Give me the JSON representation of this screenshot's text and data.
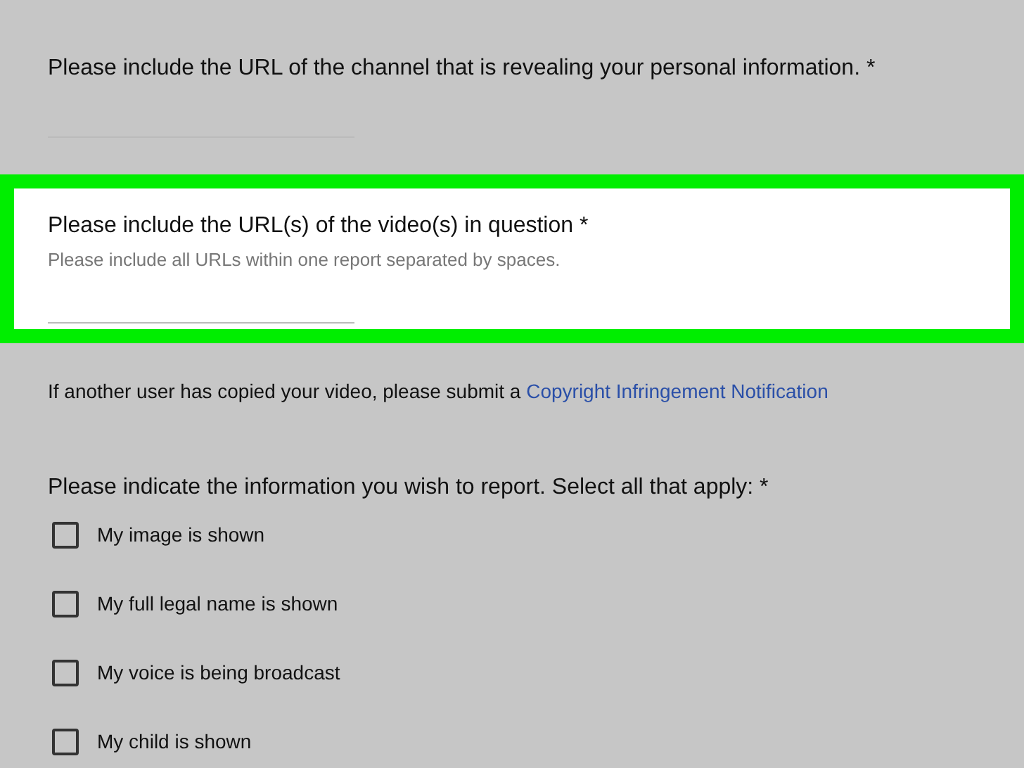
{
  "questions": [
    {
      "title": "Please include the URL of the channel that is revealing your personal information. *",
      "highlighted": false
    },
    {
      "title": "Please include the URL(s) of the video(s) in question *",
      "hint": "Please include all URLs within one report separated by spaces.",
      "highlighted": true
    }
  ],
  "notice": {
    "text": "If another user has copied your video, please submit a",
    "link": "Copyright Infringement Notification"
  },
  "checkbox_question": {
    "title": "Please indicate the information you wish to report. Select all that apply: *",
    "options": [
      {
        "label": "My image is shown",
        "checked": false
      },
      {
        "label": "My full legal name is shown",
        "checked": false
      },
      {
        "label": "My voice is being broadcast",
        "checked": false
      },
      {
        "label": "My child is shown",
        "checked": false
      }
    ]
  }
}
